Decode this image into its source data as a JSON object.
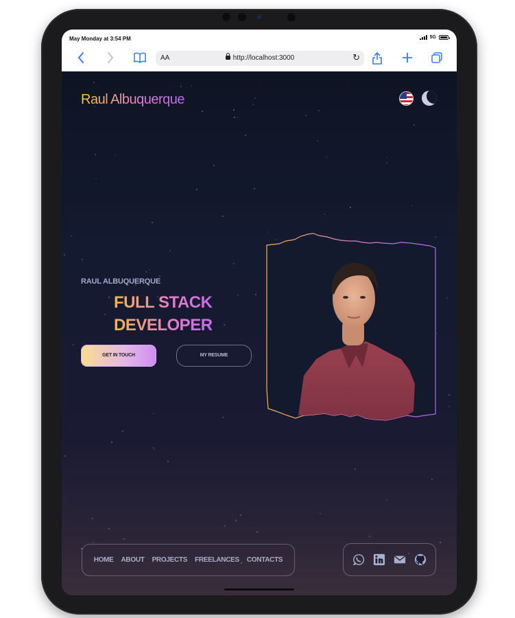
{
  "status_bar": {
    "time": "May Monday at 3:54 PM",
    "network": "5G"
  },
  "browser": {
    "address_font_toggle": "AA",
    "url": "http://localhost:3000",
    "icons": [
      "back-icon",
      "forward-icon",
      "bookmarks-icon",
      "reload-icon",
      "share-icon",
      "new-tab-icon",
      "tabs-icon"
    ]
  },
  "site": {
    "brand": "Raul Albuquerque",
    "language_flag": "us-flag-icon",
    "theme_toggle": "moon-icon",
    "hero": {
      "eyebrow": "RAUL ALBUQUERQUE",
      "headline_line1": "FULL STACK",
      "headline_line2": "DEVELOPER",
      "primary_button": "GET IN TOUCH",
      "secondary_button": "MY RESUME"
    },
    "nav": {
      "items": [
        "HOME",
        "ABOUT",
        "PROJECTS",
        "FREELANCES",
        "CONTACTS"
      ]
    },
    "social": [
      "whatsapp-icon",
      "linkedin-icon",
      "mail-icon",
      "github-icon"
    ]
  },
  "colors": {
    "brand_gradient_start": "#f7c948",
    "brand_gradient_end": "#b46cf0",
    "background": "#111527",
    "nav_text": "#a9aecb"
  }
}
